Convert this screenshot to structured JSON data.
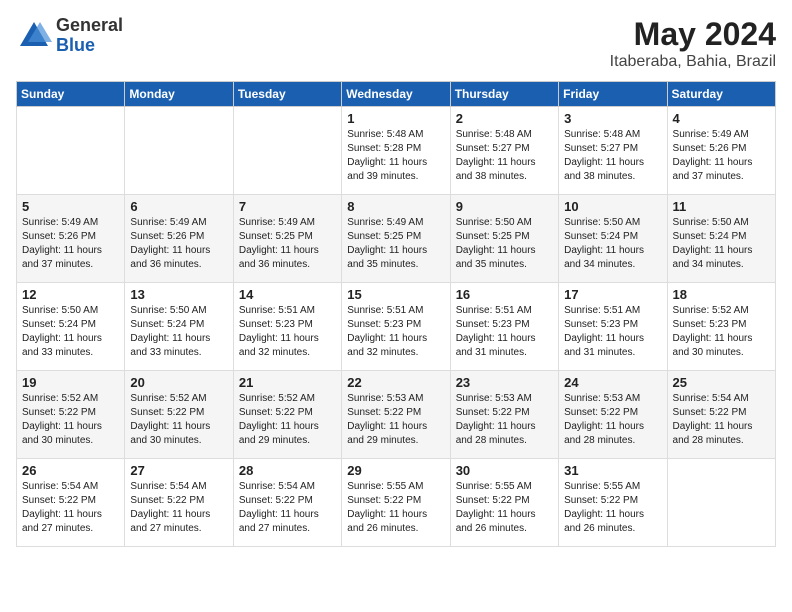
{
  "logo": {
    "general": "General",
    "blue": "Blue"
  },
  "title": {
    "month_year": "May 2024",
    "location": "Itaberaba, Bahia, Brazil"
  },
  "headers": [
    "Sunday",
    "Monday",
    "Tuesday",
    "Wednesday",
    "Thursday",
    "Friday",
    "Saturday"
  ],
  "weeks": [
    [
      {
        "day": "",
        "info": ""
      },
      {
        "day": "",
        "info": ""
      },
      {
        "day": "",
        "info": ""
      },
      {
        "day": "1",
        "info": "Sunrise: 5:48 AM\nSunset: 5:28 PM\nDaylight: 11 hours\nand 39 minutes."
      },
      {
        "day": "2",
        "info": "Sunrise: 5:48 AM\nSunset: 5:27 PM\nDaylight: 11 hours\nand 38 minutes."
      },
      {
        "day": "3",
        "info": "Sunrise: 5:48 AM\nSunset: 5:27 PM\nDaylight: 11 hours\nand 38 minutes."
      },
      {
        "day": "4",
        "info": "Sunrise: 5:49 AM\nSunset: 5:26 PM\nDaylight: 11 hours\nand 37 minutes."
      }
    ],
    [
      {
        "day": "5",
        "info": "Sunrise: 5:49 AM\nSunset: 5:26 PM\nDaylight: 11 hours\nand 37 minutes."
      },
      {
        "day": "6",
        "info": "Sunrise: 5:49 AM\nSunset: 5:26 PM\nDaylight: 11 hours\nand 36 minutes."
      },
      {
        "day": "7",
        "info": "Sunrise: 5:49 AM\nSunset: 5:25 PM\nDaylight: 11 hours\nand 36 minutes."
      },
      {
        "day": "8",
        "info": "Sunrise: 5:49 AM\nSunset: 5:25 PM\nDaylight: 11 hours\nand 35 minutes."
      },
      {
        "day": "9",
        "info": "Sunrise: 5:50 AM\nSunset: 5:25 PM\nDaylight: 11 hours\nand 35 minutes."
      },
      {
        "day": "10",
        "info": "Sunrise: 5:50 AM\nSunset: 5:24 PM\nDaylight: 11 hours\nand 34 minutes."
      },
      {
        "day": "11",
        "info": "Sunrise: 5:50 AM\nSunset: 5:24 PM\nDaylight: 11 hours\nand 34 minutes."
      }
    ],
    [
      {
        "day": "12",
        "info": "Sunrise: 5:50 AM\nSunset: 5:24 PM\nDaylight: 11 hours\nand 33 minutes."
      },
      {
        "day": "13",
        "info": "Sunrise: 5:50 AM\nSunset: 5:24 PM\nDaylight: 11 hours\nand 33 minutes."
      },
      {
        "day": "14",
        "info": "Sunrise: 5:51 AM\nSunset: 5:23 PM\nDaylight: 11 hours\nand 32 minutes."
      },
      {
        "day": "15",
        "info": "Sunrise: 5:51 AM\nSunset: 5:23 PM\nDaylight: 11 hours\nand 32 minutes."
      },
      {
        "day": "16",
        "info": "Sunrise: 5:51 AM\nSunset: 5:23 PM\nDaylight: 11 hours\nand 31 minutes."
      },
      {
        "day": "17",
        "info": "Sunrise: 5:51 AM\nSunset: 5:23 PM\nDaylight: 11 hours\nand 31 minutes."
      },
      {
        "day": "18",
        "info": "Sunrise: 5:52 AM\nSunset: 5:23 PM\nDaylight: 11 hours\nand 30 minutes."
      }
    ],
    [
      {
        "day": "19",
        "info": "Sunrise: 5:52 AM\nSunset: 5:22 PM\nDaylight: 11 hours\nand 30 minutes."
      },
      {
        "day": "20",
        "info": "Sunrise: 5:52 AM\nSunset: 5:22 PM\nDaylight: 11 hours\nand 30 minutes."
      },
      {
        "day": "21",
        "info": "Sunrise: 5:52 AM\nSunset: 5:22 PM\nDaylight: 11 hours\nand 29 minutes."
      },
      {
        "day": "22",
        "info": "Sunrise: 5:53 AM\nSunset: 5:22 PM\nDaylight: 11 hours\nand 29 minutes."
      },
      {
        "day": "23",
        "info": "Sunrise: 5:53 AM\nSunset: 5:22 PM\nDaylight: 11 hours\nand 28 minutes."
      },
      {
        "day": "24",
        "info": "Sunrise: 5:53 AM\nSunset: 5:22 PM\nDaylight: 11 hours\nand 28 minutes."
      },
      {
        "day": "25",
        "info": "Sunrise: 5:54 AM\nSunset: 5:22 PM\nDaylight: 11 hours\nand 28 minutes."
      }
    ],
    [
      {
        "day": "26",
        "info": "Sunrise: 5:54 AM\nSunset: 5:22 PM\nDaylight: 11 hours\nand 27 minutes."
      },
      {
        "day": "27",
        "info": "Sunrise: 5:54 AM\nSunset: 5:22 PM\nDaylight: 11 hours\nand 27 minutes."
      },
      {
        "day": "28",
        "info": "Sunrise: 5:54 AM\nSunset: 5:22 PM\nDaylight: 11 hours\nand 27 minutes."
      },
      {
        "day": "29",
        "info": "Sunrise: 5:55 AM\nSunset: 5:22 PM\nDaylight: 11 hours\nand 26 minutes."
      },
      {
        "day": "30",
        "info": "Sunrise: 5:55 AM\nSunset: 5:22 PM\nDaylight: 11 hours\nand 26 minutes."
      },
      {
        "day": "31",
        "info": "Sunrise: 5:55 AM\nSunset: 5:22 PM\nDaylight: 11 hours\nand 26 minutes."
      },
      {
        "day": "",
        "info": ""
      }
    ]
  ]
}
